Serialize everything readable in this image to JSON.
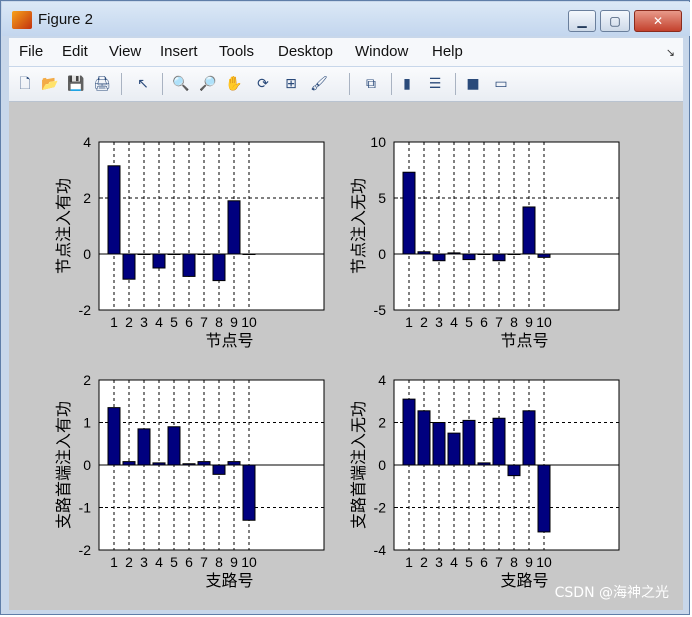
{
  "window": {
    "title": "Figure 2",
    "buttons": {
      "minimize": "▁",
      "maximize": "▢",
      "close": "✕"
    }
  },
  "menubar": [
    "File",
    "Edit",
    "View",
    "Insert",
    "Tools",
    "Desktop",
    "Window",
    "Help"
  ],
  "menubar_overflow": "↘",
  "toolbar": {
    "icons": [
      "new-figure-icon",
      "open-file-icon",
      "save-icon",
      "print-icon",
      "pointer-icon",
      "zoom-in-icon",
      "zoom-out-icon",
      "pan-hand-icon",
      "rotate-3d-icon",
      "data-cursor-icon",
      "brush-icon",
      "link-plot-icon",
      "colorbar-icon",
      "legend-icon",
      "hide-plot-tools-icon",
      "show-plot-tools-icon"
    ],
    "glyphs": [
      "🗋",
      "📂",
      "💾",
      "🖨",
      "↖",
      "🔍",
      "🔎",
      "✋",
      "⟳",
      "⊞",
      "🖌",
      "⧉",
      "▮",
      "☰",
      "■",
      "▭"
    ]
  },
  "colors": {
    "bar": "#00007f",
    "axes_bg": "#ffffff",
    "figure_bg": "#c8c8c8"
  },
  "credit": "CSDN @海神之光",
  "chart_data": [
    {
      "type": "bar",
      "ylabel": "节点注入有功",
      "xlabel": "节点号",
      "categories": [
        "1",
        "2",
        "3",
        "4",
        "5",
        "6",
        "7",
        "8",
        "9",
        "10"
      ],
      "values": [
        3.15,
        -0.9,
        0,
        -0.5,
        0,
        -0.8,
        0,
        -0.95,
        1.9,
        0
      ],
      "ylim": [
        -2,
        4
      ],
      "yticks": [
        -2,
        0,
        2,
        4
      ],
      "grid": "dashed"
    },
    {
      "type": "bar",
      "ylabel": "节点注入无功",
      "xlabel": "节点号",
      "categories": [
        "1",
        "2",
        "3",
        "4",
        "5",
        "6",
        "7",
        "8",
        "9",
        "10"
      ],
      "values": [
        7.3,
        0.2,
        -0.6,
        0.1,
        -0.5,
        0,
        -0.6,
        0,
        4.2,
        -0.3
      ],
      "ylim": [
        -5,
        10
      ],
      "yticks": [
        -5,
        0,
        5,
        10
      ],
      "grid": "dashed"
    },
    {
      "type": "bar",
      "ylabel": "支路首端注入有功",
      "xlabel": "支路号",
      "categories": [
        "1",
        "2",
        "3",
        "4",
        "5",
        "6",
        "7",
        "8",
        "9",
        "10"
      ],
      "values": [
        1.35,
        0.08,
        0.85,
        0.05,
        0.9,
        0.03,
        0.08,
        -0.22,
        0.08,
        -1.3
      ],
      "ylim": [
        -2,
        2
      ],
      "yticks": [
        -2,
        -1,
        0,
        1,
        2
      ],
      "grid": "dashed"
    },
    {
      "type": "bar",
      "ylabel": "支路首端注入无功",
      "xlabel": "支路号",
      "categories": [
        "1",
        "2",
        "3",
        "4",
        "5",
        "6",
        "7",
        "8",
        "9",
        "10"
      ],
      "values": [
        3.1,
        2.55,
        2.0,
        1.5,
        2.1,
        0.1,
        2.2,
        -0.5,
        2.55,
        -3.15
      ],
      "ylim": [
        -4,
        4
      ],
      "yticks": [
        -4,
        -2,
        0,
        2,
        4
      ],
      "grid": "dashed"
    }
  ]
}
